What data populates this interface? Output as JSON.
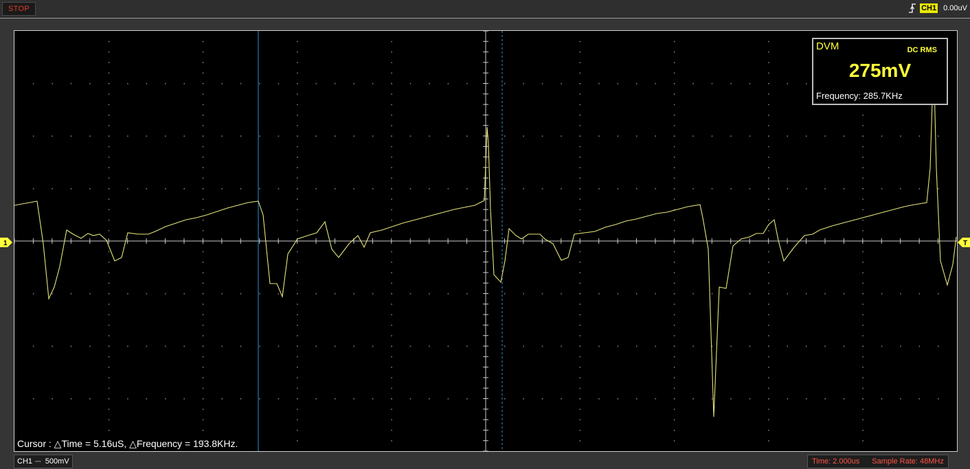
{
  "status": {
    "run_state": "STOP"
  },
  "trigger": {
    "edge_icon": "rising-edge-icon",
    "source": "CH1",
    "level": "0.00uV"
  },
  "dvm": {
    "title": "DVM",
    "mode": "DC RMS",
    "value": "275mV",
    "frequency": "Frequency: 285.7KHz"
  },
  "cursor": {
    "readout": "Cursor : △Time = 5.16uS, △Frequency = 193.8KHz."
  },
  "markers": {
    "channel_marker": "1",
    "trigger_marker": "T"
  },
  "channel": {
    "name": "CH1",
    "coupling": "⎓",
    "scale": "500mV"
  },
  "timebase": {
    "time": "Time: 2.000us",
    "sample_rate": "Sample Rate: 48MHz"
  },
  "colors": {
    "trace": "#e6e67a",
    "cursor": "#2f8fd6",
    "grid": "#8a8a8a",
    "stop": "#e23a2a",
    "accent": "#ffff3a"
  }
}
